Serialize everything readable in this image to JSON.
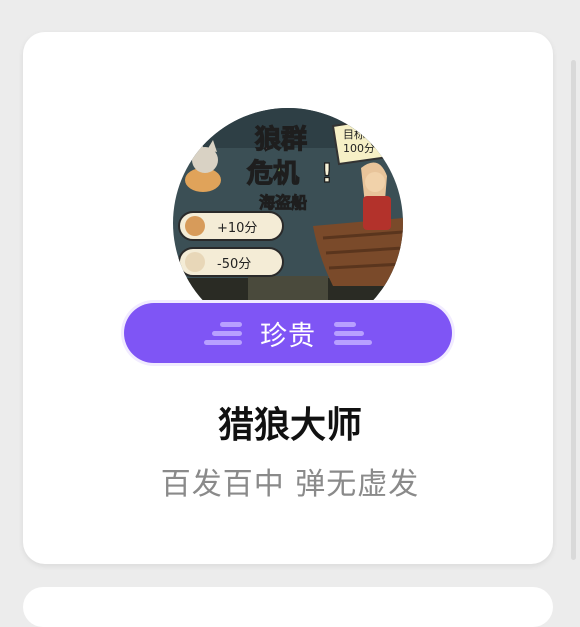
{
  "badge": {
    "art": {
      "game_title_line1": "狼群",
      "game_title_line2": "危机",
      "exclaim": "!",
      "subtitle": "海盗船",
      "goal_line1": "目标",
      "goal_line2": "100分",
      "score_plus": "+10分",
      "score_minus": "-50分"
    },
    "rarity": "珍贵",
    "name": "猎狼大师",
    "description": "百发百中 弹无虚发"
  },
  "colors": {
    "rarity_purple": "#7f55f5",
    "background": "#ececec",
    "card": "#ffffff"
  }
}
